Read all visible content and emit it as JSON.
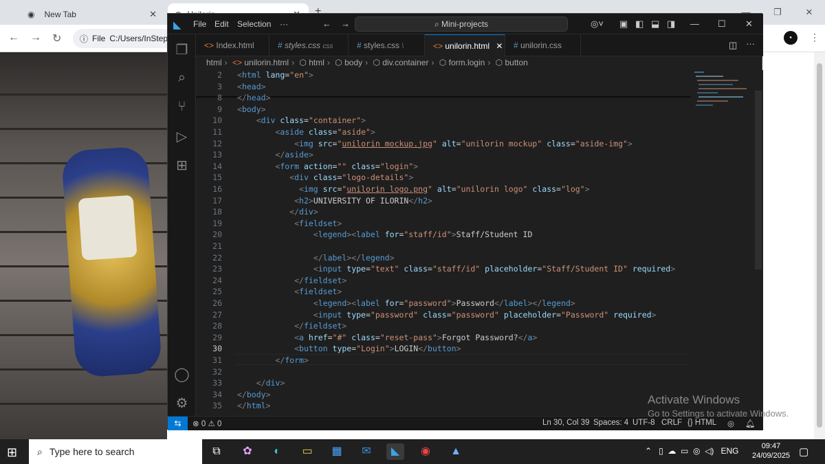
{
  "browser": {
    "tabs": [
      {
        "title": "New Tab"
      },
      {
        "title": "Unilorin"
      }
    ],
    "new_tab_glyph": "+",
    "omnibox": {
      "scheme": "File",
      "url": "C:/Users/InStep"
    }
  },
  "vscode": {
    "menu": [
      "File",
      "Edit",
      "Selection",
      "···"
    ],
    "command_center": "Mini-projects",
    "tabs": [
      {
        "label": "Index.html",
        "kind": "html",
        "suffix": ""
      },
      {
        "label": "styles.css",
        "kind": "css",
        "suffix": "css"
      },
      {
        "label": "styles.css",
        "kind": "css",
        "suffix": "\\"
      },
      {
        "label": "unilorin.html",
        "kind": "html",
        "suffix": ""
      },
      {
        "label": "unilorin.css",
        "kind": "css",
        "suffix": ""
      }
    ],
    "breadcrumbs": [
      "html",
      "unilorin.html",
      "html",
      "body",
      "div.container",
      "form.login",
      "button"
    ],
    "line_numbers": [
      "2",
      "3",
      "8",
      "9",
      "10",
      "11",
      "12",
      "13",
      "14",
      "15",
      "16",
      "17",
      "18",
      "19",
      "20",
      "21",
      "22",
      "23",
      "24",
      "25",
      "26",
      "27",
      "28",
      "29",
      "30",
      "31",
      "32",
      "33",
      "34",
      "35"
    ],
    "current_line": "30",
    "status": {
      "errors": "0",
      "warnings": "0",
      "position": "Ln 30, Col 39",
      "spaces": "Spaces: 4",
      "encoding": "UTF-8",
      "eol": "CRLF",
      "language": "HTML"
    }
  },
  "watermark": {
    "heading": "Activate Windows",
    "detail": "Go to Settings to activate Windows."
  },
  "taskbar": {
    "search_placeholder": "Type here to search",
    "language": "ENG",
    "time": "09:47",
    "date": "24/09/2025"
  },
  "colors": {
    "accent": "#0078d4",
    "tag": "#569cd6",
    "attr": "#9cdcfe",
    "string": "#ce9178"
  }
}
